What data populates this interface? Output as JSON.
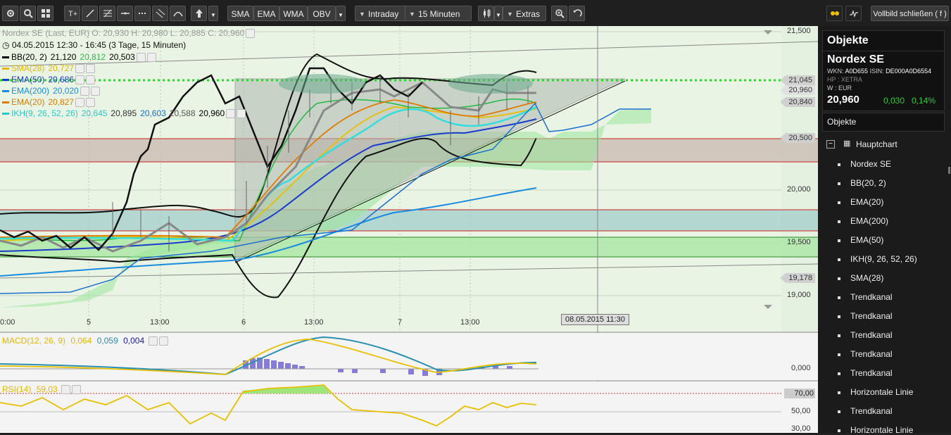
{
  "toolbar": {
    "indicator_buttons": [
      "SMA",
      "EMA",
      "WMA",
      "OBV"
    ],
    "interval_mode": "Intraday",
    "interval": "15 Minuten",
    "extras": "Extras",
    "fullscreen": "Vollbild schließen ( f )"
  },
  "chart": {
    "instrument_line": "Nordex SE (Last, EUR)  O: 20,930  H: 20,980  L: 20,885  C: 20,960",
    "period_line": "04.05.2015 12:30 - 16:45 (3 Tage, 15 Minuten)",
    "indicators": [
      {
        "name": "BB(20, 2)",
        "vals": [
          "21,120",
          "20,812",
          "20,503"
        ],
        "colors": [
          "#000000",
          "#39b54a",
          "#000000"
        ],
        "name_color": "#000000"
      },
      {
        "name": "SMA(28)",
        "vals": [
          "20,727"
        ],
        "colors": [
          "#e6b800"
        ],
        "name_color": "#e6b800"
      },
      {
        "name": "EMA(50)",
        "vals": [
          "20,686"
        ],
        "colors": [
          "#1a3ccc"
        ],
        "name_color": "#1a3ccc"
      },
      {
        "name": "EMA(200)",
        "vals": [
          "20,020"
        ],
        "colors": [
          "#1a8ce0"
        ],
        "name_color": "#1a8ce0"
      },
      {
        "name": "EMA(20)",
        "vals": [
          "20,827"
        ],
        "colors": [
          "#e07b00"
        ],
        "name_color": "#e07b00"
      },
      {
        "name": "IKH(9, 26, 52, 26)",
        "vals": [
          "20,645",
          "20,895",
          "20,603",
          "20,588",
          "20,960"
        ],
        "colors": [
          "#22cccc",
          "#333333",
          "#1a6fd0",
          "#555555",
          "#000000"
        ],
        "name_color": "#22cccc"
      }
    ],
    "y_labels": [
      "21,500",
      "20,000",
      "19,500",
      "19,000"
    ],
    "price_tags": [
      "21,045",
      "20,960",
      "20,840",
      "20,500",
      "19,178"
    ],
    "x_labels": [
      "0:00",
      "5",
      "13:00",
      "6",
      "13:00",
      "7",
      "13:00"
    ],
    "crosshair_date": "08.05.2015 11:30",
    "macd": {
      "name": "MACD(12, 26, 9)",
      "vals": [
        "0,064",
        "0,059",
        "0,004"
      ],
      "colors": [
        "#e6b800",
        "#2a8fb0",
        "#1a1a9a"
      ],
      "zero_label": "0,000"
    },
    "rsi": {
      "name": "RSI(14)",
      "val": "59,03",
      "labels": [
        "70,00",
        "50,00",
        "30,00"
      ]
    }
  },
  "sidebar": {
    "title": "Objekte",
    "instrument": "Nordex SE",
    "wkn_label": "WKN:",
    "wkn": "A0D655",
    "isin_label": "ISIN:",
    "isin": "DE000A0D6554",
    "exchange_label": "HP : XETRA",
    "currency_label": "W : EUR",
    "price": "20,960",
    "change": "0,030",
    "change_pct": "0,14%",
    "objects_header": "Objekte",
    "group": "Hauptchart",
    "items": [
      "Nordex SE",
      "BB(20, 2)",
      "EMA(20)",
      "EMA(200)",
      "EMA(50)",
      "IKH(9, 26, 52, 26)",
      "SMA(28)",
      "Trendkanal",
      "Trendkanal",
      "Trendkanal",
      "Trendkanal",
      "Trendkanal",
      "Horizontale Linie",
      "Trendkanal",
      "Horizontale Linie"
    ]
  }
}
